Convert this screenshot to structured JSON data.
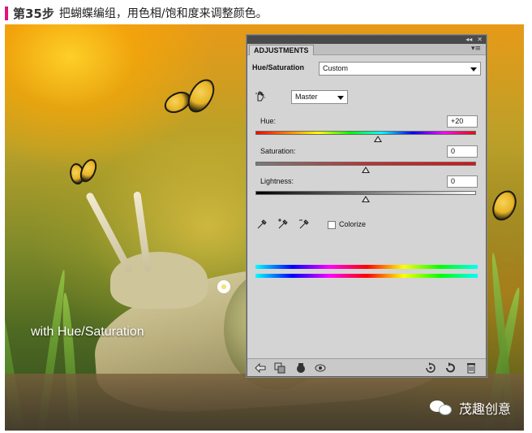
{
  "heading": {
    "step": "第35步",
    "text": "把蝴蝶编组，用色相/饱和度来调整颜色。",
    "accent_color": "#e0147a"
  },
  "scene": {
    "caption": "with Hue/Saturation",
    "watermark": "茂趣创意",
    "watermark_icon": "wechat-icon"
  },
  "panel": {
    "tab_label": "ADJUSTMENTS",
    "topbar": {
      "collapse_glyph": "◂◂",
      "close_glyph": "✕"
    },
    "menu_glyph": "▾≡",
    "adjustment_name": "Hue/Saturation",
    "preset": "Custom",
    "channel": "Master",
    "targeted_adjust_icon": "hand-scrub-icon",
    "hue": {
      "label": "Hue:",
      "value": "+20",
      "level": 20,
      "min": -180,
      "max": 180
    },
    "saturation": {
      "label": "Saturation:",
      "value": "0",
      "level": 0,
      "min": -100,
      "max": 100
    },
    "lightness": {
      "label": "Lightness:",
      "value": "0",
      "level": 0,
      "min": -100,
      "max": 100
    },
    "eyedroppers": [
      "eyedropper-icon",
      "eyedropper-plus-icon",
      "eyedropper-minus-icon"
    ],
    "colorize": {
      "label": "Colorize",
      "checked": false
    },
    "bottom_left_icons": [
      "back-arrow-icon",
      "clip-layer-icon",
      "layer-visibility-drop-icon",
      "eye-icon"
    ],
    "bottom_right_icons": [
      "previous-state-icon",
      "reset-icon",
      "trash-icon"
    ]
  }
}
